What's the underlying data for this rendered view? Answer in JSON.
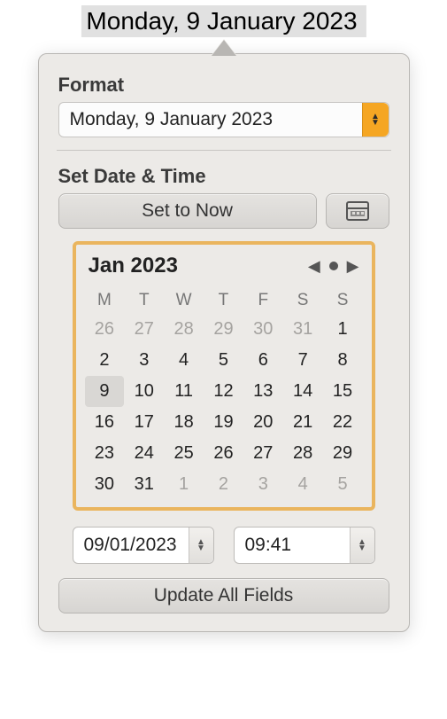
{
  "header_date_text": "Monday, 9 January 2023",
  "format": {
    "label": "Format",
    "selected": "Monday, 9 January 2023"
  },
  "set_section": {
    "label": "Set Date & Time",
    "set_now": "Set to Now"
  },
  "calendar": {
    "title": "Jan 2023",
    "weekdays": [
      "M",
      "T",
      "W",
      "T",
      "F",
      "S",
      "S"
    ],
    "rows": [
      [
        {
          "d": "26",
          "dim": true
        },
        {
          "d": "27",
          "dim": true
        },
        {
          "d": "28",
          "dim": true
        },
        {
          "d": "29",
          "dim": true
        },
        {
          "d": "30",
          "dim": true
        },
        {
          "d": "31",
          "dim": true
        },
        {
          "d": "1"
        }
      ],
      [
        {
          "d": "2"
        },
        {
          "d": "3"
        },
        {
          "d": "4"
        },
        {
          "d": "5"
        },
        {
          "d": "6"
        },
        {
          "d": "7"
        },
        {
          "d": "8"
        }
      ],
      [
        {
          "d": "9",
          "sel": true
        },
        {
          "d": "10"
        },
        {
          "d": "11"
        },
        {
          "d": "12"
        },
        {
          "d": "13"
        },
        {
          "d": "14"
        },
        {
          "d": "15"
        }
      ],
      [
        {
          "d": "16"
        },
        {
          "d": "17"
        },
        {
          "d": "18"
        },
        {
          "d": "19"
        },
        {
          "d": "20"
        },
        {
          "d": "21"
        },
        {
          "d": "22"
        }
      ],
      [
        {
          "d": "23"
        },
        {
          "d": "24"
        },
        {
          "d": "25"
        },
        {
          "d": "26"
        },
        {
          "d": "27"
        },
        {
          "d": "28"
        },
        {
          "d": "29"
        }
      ],
      [
        {
          "d": "30"
        },
        {
          "d": "31"
        },
        {
          "d": "1",
          "dim": true
        },
        {
          "d": "2",
          "dim": true
        },
        {
          "d": "3",
          "dim": true
        },
        {
          "d": "4",
          "dim": true
        },
        {
          "d": "5",
          "dim": true
        }
      ]
    ]
  },
  "inputs": {
    "date": "09/01/2023",
    "time": "09:41"
  },
  "update_label": "Update All Fields",
  "colors": {
    "accent": "#f5a623",
    "highlight_border": "#eab55e"
  }
}
